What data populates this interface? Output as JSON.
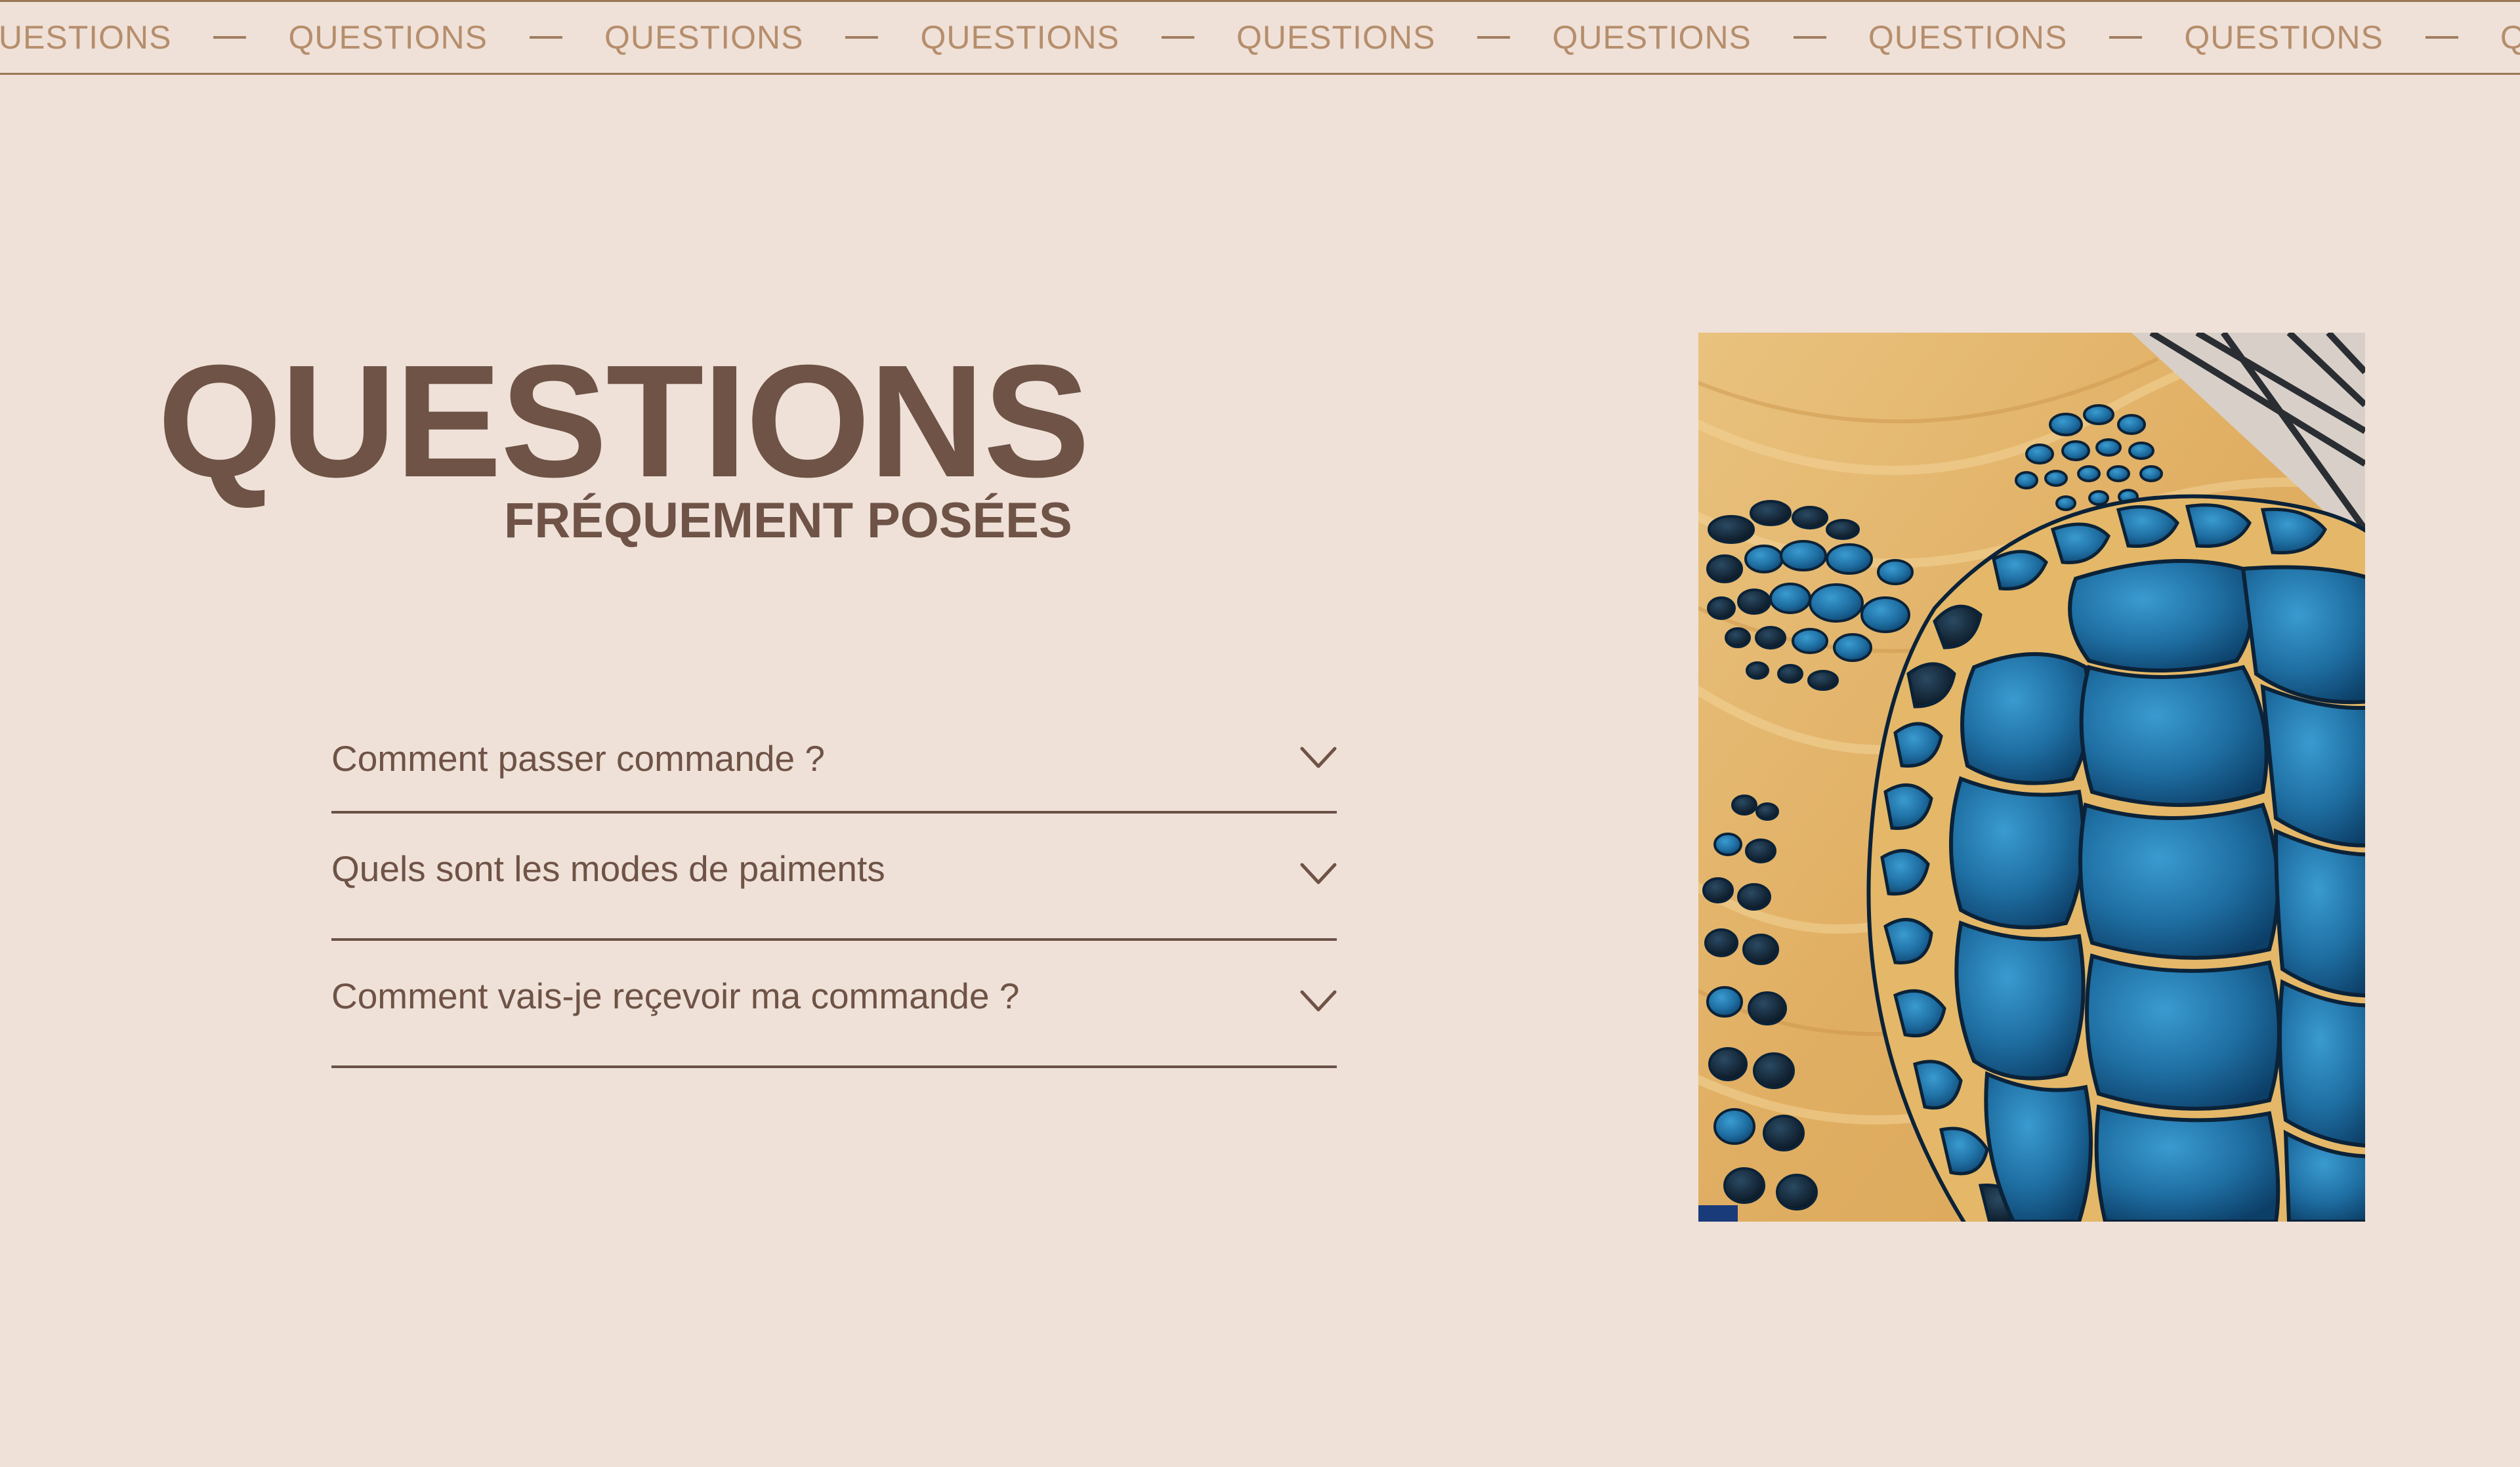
{
  "marquee": {
    "word": "QUESTIONS",
    "repeat_count": 9
  },
  "heading": {
    "title": "QUESTIONS",
    "subtitle": "FRÉQUEMENT POSÉES"
  },
  "faq": {
    "items": [
      {
        "question": "Comment passer commande ?",
        "icon": "chevron-down-icon"
      },
      {
        "question": "Quels sont les modes de paiments",
        "icon": "chevron-down-icon"
      },
      {
        "question": "Comment vais-je reçevoir ma commande ?",
        "icon": "chevron-down-icon"
      }
    ]
  },
  "image": {
    "subject": "resin-turtle-artwork"
  },
  "colors": {
    "background": "#EFE1D8",
    "heading_brown": "#6E5346",
    "marquee_text": "#B68E6C",
    "marquee_border": "#9C7757",
    "divider": "#6A5146",
    "resin_blue": "#1F73A8",
    "wood": "#E3B46A"
  }
}
